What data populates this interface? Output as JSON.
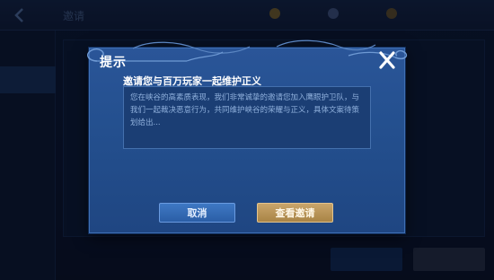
{
  "background": {
    "title": "邀请",
    "sidebar_items": [
      "",
      "",
      ""
    ]
  },
  "dialog": {
    "title": "提示",
    "subtitle": "邀请您与百万玩家一起维护正义",
    "message": "您在峡谷的高素质表现，我们非常诚挚的邀请您加入鹰眼护卫队，与我们一起裁决恶意行为，共同维护峡谷的荣耀与正义，具体文案待策划给出...",
    "cancel_label": "取消",
    "view_label": "查看邀请",
    "close_icon": "close-icon"
  },
  "colors": {
    "dialog_bg": "#24508f",
    "cancel_button": "#2b5ea6",
    "view_button": "#a98446",
    "text_primary": "#ffffff",
    "text_secondary": "#8fb0dc"
  }
}
